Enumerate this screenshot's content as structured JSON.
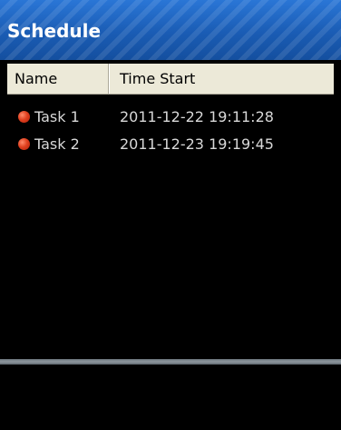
{
  "title": "Schedule",
  "columns": {
    "name": "Name",
    "time_start": "Time Start"
  },
  "tasks": [
    {
      "name": "Task 1",
      "time_start": "2011-12-22 19:11:28",
      "status_color": "#e0401f"
    },
    {
      "name": "Task 2",
      "time_start": "2011-12-23 19:19:45",
      "status_color": "#e0401f"
    }
  ],
  "colors": {
    "title_bar": "#1f63bd",
    "header_bg": "#ece9d8",
    "background": "#000000",
    "row_text": "#d8d8d8"
  },
  "icons": {
    "task_status": "red-dot-icon"
  }
}
